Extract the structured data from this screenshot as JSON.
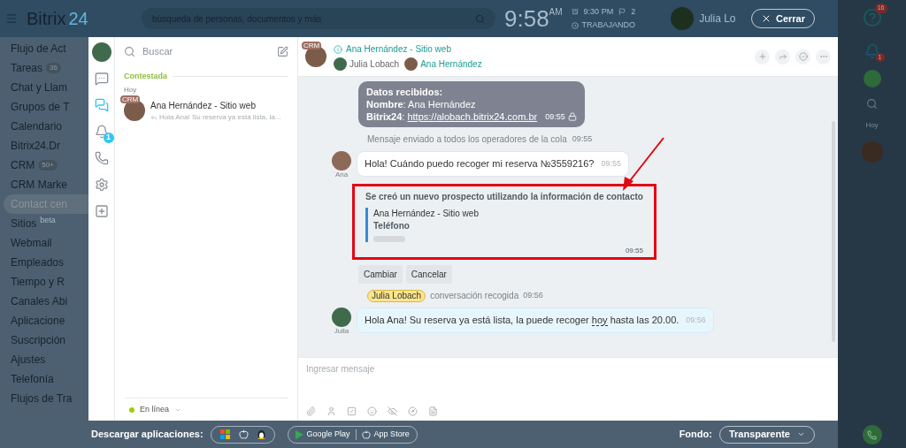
{
  "top_bar": {
    "logo_text": "Bitrix",
    "logo_number": "24",
    "search_placeholder": "búsqueda de personas, documentos y más",
    "clock": "9:58",
    "clock_suffix": "AM",
    "alarm": "9:30 PM",
    "flag_count": "2",
    "work_status": "TRABAJANDO",
    "user_name": "Julia Lo",
    "close_button": "Cerrar"
  },
  "sidebar": {
    "items": [
      {
        "label": "Flujo de Act",
        "selected": false
      },
      {
        "label": "Tareas",
        "counter": "36",
        "selected": false
      },
      {
        "label": "Chat y Llam",
        "selected": false
      },
      {
        "label": "Grupos de T",
        "selected": false
      },
      {
        "label": "Calendario",
        "selected": false
      },
      {
        "label": "Bitrix24.Dr",
        "selected": false
      },
      {
        "label": "CRM",
        "counter": "50+",
        "selected": false
      },
      {
        "label": "CRM Marke",
        "selected": false
      },
      {
        "label": "Contact cen",
        "selected": true
      },
      {
        "label": "Sitios",
        "superscript": "beta",
        "selected": false
      },
      {
        "label": "Webmail",
        "selected": false
      },
      {
        "label": "Empleados",
        "selected": false
      },
      {
        "label": "Tiempo y R",
        "selected": false
      },
      {
        "label": "Canales Abi",
        "selected": false
      },
      {
        "label": "Aplicacione",
        "selected": false
      },
      {
        "label": "Suscripción",
        "selected": false
      },
      {
        "label": "Ajustes",
        "selected": false
      },
      {
        "label": "Telefonía",
        "selected": false
      },
      {
        "label": "Flujos de Tra",
        "selected": false
      }
    ]
  },
  "rail": {
    "items": [
      {
        "kind": "chats",
        "selected": false
      },
      {
        "kind": "openlines",
        "selected": true
      },
      {
        "kind": "notifications",
        "badge": "1",
        "selected": false
      },
      {
        "kind": "calls",
        "selected": false
      },
      {
        "kind": "settings",
        "selected": false
      },
      {
        "kind": "add",
        "selected": false
      }
    ]
  },
  "chat_list": {
    "search_placeholder": "Buscar",
    "group": "Contestada",
    "day": "Hoy",
    "items": [
      {
        "badge": "CRM",
        "name": "Ana Hernández - Sitio web",
        "preview": "Hola Ana! Su reserva ya está lista, la...",
        "selected": false
      }
    ],
    "status": "En línea"
  },
  "chat": {
    "badge": "CRM",
    "title": "Ana Hernández - Sitio web",
    "participants": [
      {
        "name": "Julia Lobach",
        "kind": "operator"
      },
      {
        "name": "Ana Hernández",
        "kind": "client"
      }
    ],
    "messages": [
      {
        "kind": "data",
        "title": "Datos recibidos:",
        "lines": [
          {
            "text": "**Nombre**: Ana Hernández"
          },
          {
            "text": "**Bitrix24**:",
            "link": "https://alobach.bitrix24.com.br"
          }
        ],
        "time": "09:55"
      },
      {
        "kind": "system",
        "text": "Mensaje enviado a todos los operadores de la cola",
        "time": "09:55"
      },
      {
        "kind": "incoming",
        "author": "Ana",
        "text": "Hola! Cuándo puedo recoger mi reserva №3559216?",
        "time": "09:55"
      },
      {
        "kind": "lead_card",
        "title": "Se creó un nuevo prospecto utilizando la información de contacto",
        "name": "Ana Hernández - Sitio web",
        "field": "Teléfono",
        "time": "09:55"
      },
      {
        "kind": "actions",
        "buttons": [
          "Cambiar",
          "Cancelar"
        ]
      },
      {
        "kind": "event",
        "tag": "Julia Lobach",
        "text": "conversación recogida",
        "time": "09:56"
      },
      {
        "kind": "outgoing",
        "author": "Julia",
        "text_before": "Hola Ana! Su reserva ya está lista, la puede recoger ",
        "keyword": "hoy",
        "text_after": " hasta las 20.00.",
        "time": "09:56"
      }
    ],
    "input_placeholder": "Ingresar mensaje"
  },
  "right_panel": {
    "help_badge": "16",
    "notification_badge": "1",
    "day": "Hoy"
  },
  "bottom_bar": {
    "apps_label": "Descargar aplicaciones:",
    "stores": [
      "Google Play",
      "App Store"
    ],
    "background_label": "Fondo:",
    "background_value": "Transparente"
  }
}
